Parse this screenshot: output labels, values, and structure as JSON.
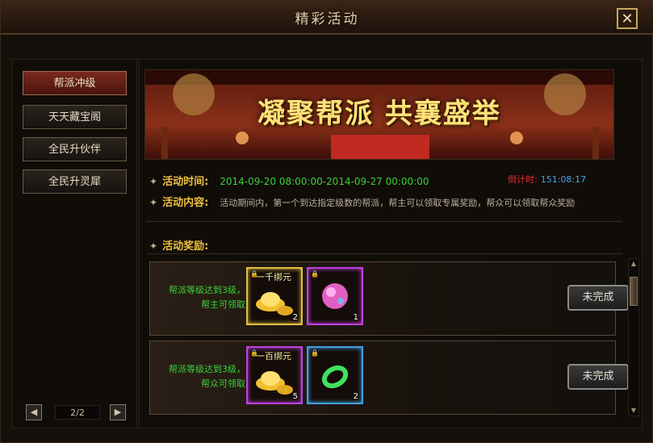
{
  "window": {
    "title": "精彩活动",
    "close_label": "✕"
  },
  "sidebar": {
    "items": [
      {
        "label": "帮派冲级",
        "active": true
      },
      {
        "label": "天天藏宝阁",
        "active": false
      },
      {
        "label": "全民升伙伴",
        "active": false
      },
      {
        "label": "全民升灵犀",
        "active": false
      }
    ],
    "pager": {
      "prev": "◀",
      "text": "2/2",
      "next": "▶"
    }
  },
  "banner": {
    "text": "凝聚帮派 共襄盛举"
  },
  "info": {
    "time_label": "活动时间:",
    "time_value": "2014-09-20 08:00:00-2014-09-27 00:00:00",
    "countdown_label": "倒计时:",
    "countdown_value": "151:08:17",
    "content_label": "活动内容:",
    "content_value": "活动期间内，第一个到达指定级数的帮派，帮主可以领取专属奖励，帮众可以领取帮众奖励",
    "rewards_label": "活动奖励:"
  },
  "rewards": [
    {
      "desc": "帮派等级达到3级，帮主可领取",
      "items": [
        {
          "name": "一千绑元",
          "count": "2",
          "rarity": "gold",
          "icon": "gold-ingot-icon"
        },
        {
          "name": "",
          "count": "1",
          "rarity": "purple",
          "icon": "pink-orb-icon"
        }
      ],
      "status": "未完成"
    },
    {
      "desc": "帮派等级达到3级，帮众可领取",
      "items": [
        {
          "name": "一百绑元",
          "count": "5",
          "rarity": "purple",
          "icon": "gold-ingot-icon"
        },
        {
          "name": "",
          "count": "2",
          "rarity": "blue",
          "icon": "jade-ring-icon"
        }
      ],
      "status": "未完成"
    }
  ],
  "scrollbar": {
    "up": "▲",
    "down": "▼"
  }
}
